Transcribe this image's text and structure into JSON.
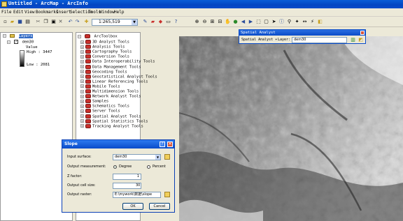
{
  "window": {
    "title": "Untitled - ArcMap - ArcInfo"
  },
  "menu": [
    "File",
    "Edit",
    "View",
    "Bookmarks",
    "Insert",
    "Selection",
    "Tools",
    "Window",
    "Help"
  ],
  "toolbar": {
    "scale": "1:265,519"
  },
  "toc": {
    "root": "Layers",
    "layer": "dem30",
    "legend_title": "Value",
    "high": "High : 3447",
    "low": "Low : 2081"
  },
  "toolbox": {
    "root": "ArcToolbox",
    "items": [
      "3D Analyst Tools",
      "Analysis Tools",
      "Cartography Tools",
      "Conversion Tools",
      "Data Interoperability Tools",
      "Data Management Tools",
      "Geocoding Tools",
      "Geostatistical Analyst Tools",
      "Linear Referencing Tools",
      "Mobile Tools",
      "Multidimension Tools",
      "Network Analyst Tools",
      "Samples",
      "Schematics Tools",
      "Server Tools",
      "Spatial Analyst Tools",
      "Spatial Statistics Tools",
      "Tracking Analyst Tools"
    ]
  },
  "spatial_analyst": {
    "title": "Spatial Analyst",
    "menu": "Spatial Analyst",
    "layer_label": "Layer:",
    "layer_value": "dem30"
  },
  "dialog": {
    "title": "Slope",
    "input_label": "Input surface:",
    "input_value": "dem30",
    "measurement_label": "Output measurement:",
    "degree": "Degree",
    "percent": "Percent",
    "z_label": "Z factor:",
    "z_value": "1",
    "cell_label": "Output cell size:",
    "cell_value": "30",
    "raster_label": "Output raster:",
    "raster_value": "E:\\mywork\\数据\\slope",
    "ok": "OK",
    "cancel": "Cancel"
  }
}
